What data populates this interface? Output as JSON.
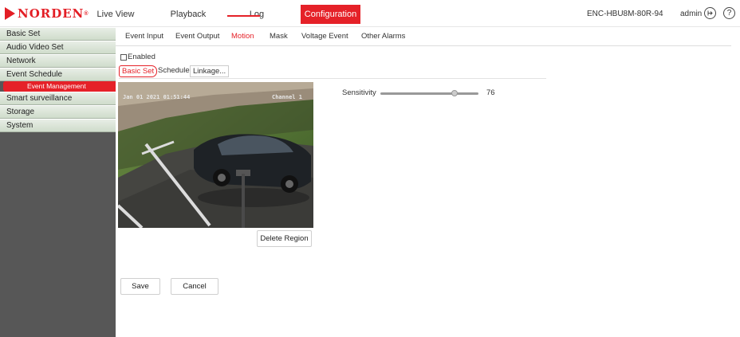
{
  "brand": {
    "name": "NORDEN",
    "reg": "®",
    "color": "#e31e25"
  },
  "topnav": [
    {
      "label": "Live View"
    },
    {
      "label": "Playback"
    },
    {
      "label": "Log"
    },
    {
      "label": "Configuration",
      "active": true
    }
  ],
  "header": {
    "device": "ENC-HBU8M-80R-94",
    "user": "admin",
    "logout_icon": "logout-icon",
    "help_icon": "help-icon"
  },
  "sidebar": {
    "items": [
      {
        "label": "Basic Set"
      },
      {
        "label": "Audio Video Set"
      },
      {
        "label": "Network"
      },
      {
        "label": "Event Schedule"
      },
      {
        "label": "Event Management",
        "selected": true
      },
      {
        "label": "Smart surveillance"
      },
      {
        "label": "Storage"
      },
      {
        "label": "System"
      }
    ]
  },
  "subtabs": [
    {
      "label": "Event Input"
    },
    {
      "label": "Event Output"
    },
    {
      "label": "Motion",
      "active": true
    },
    {
      "label": "Mask"
    },
    {
      "label": "Voltage Event"
    },
    {
      "label": "Other Alarms"
    }
  ],
  "enabled": {
    "label": "Enabled",
    "checked": false
  },
  "innertabs": [
    {
      "label": "Basic Set",
      "active": true
    },
    {
      "label": "Schedule"
    },
    {
      "label": "Linkage..."
    }
  ],
  "video": {
    "timestamp": "Jan 01 2021 01:51:44",
    "channel": "Channel 1"
  },
  "delete_region": "Delete Region",
  "sensitivity": {
    "label": "Sensitivity",
    "value": "76",
    "fraction": 0.76
  },
  "buttons": {
    "save": "Save",
    "cancel": "Cancel"
  },
  "colors": {
    "accent": "#e52128",
    "sidebar_bg": "#575757"
  }
}
